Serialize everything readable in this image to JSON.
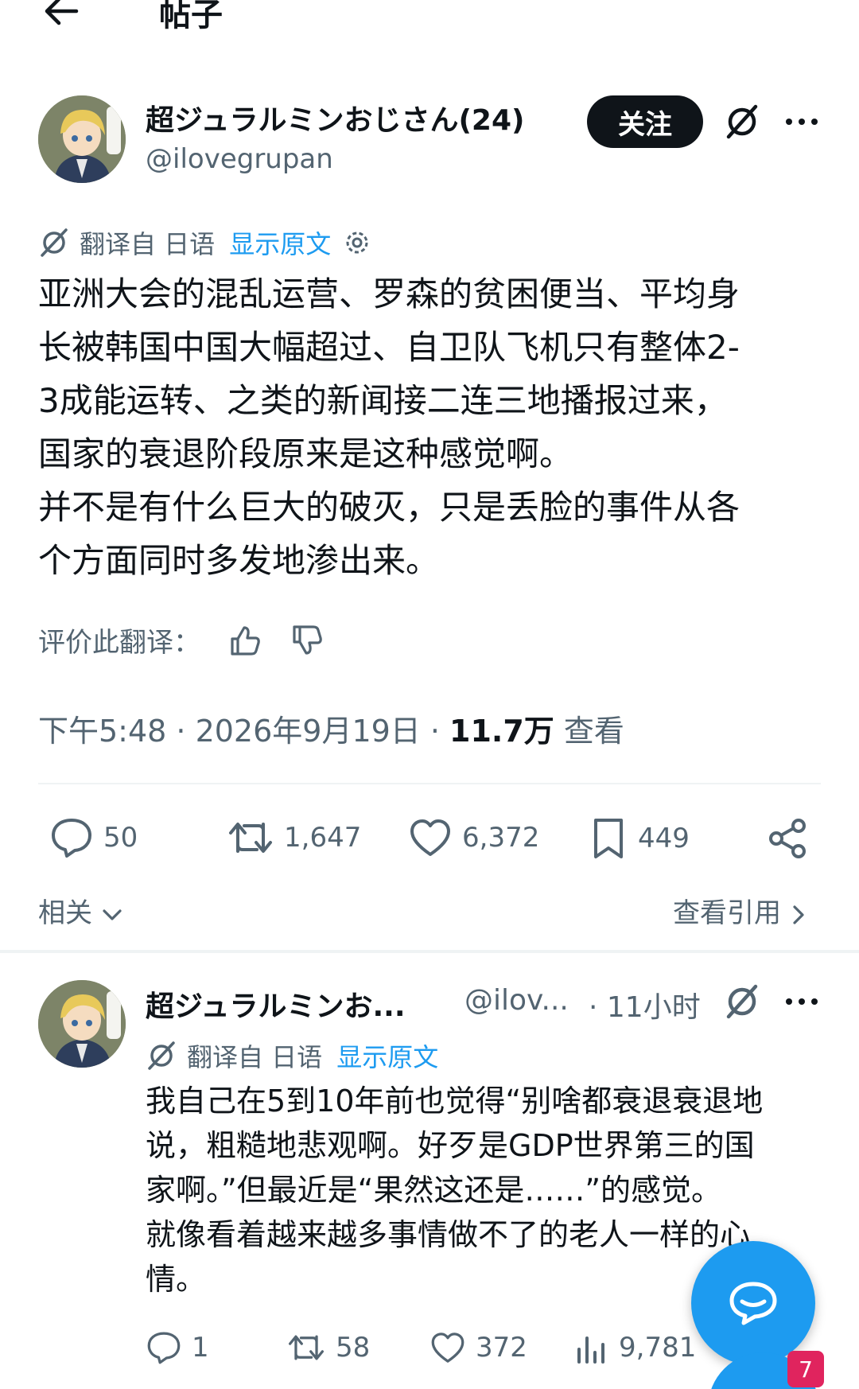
{
  "header": {
    "title": "帖子"
  },
  "post": {
    "author_name": "超ジュラルミンおじさん(24)",
    "author_handle": "@ilovegrupan",
    "follow_label": "关注",
    "translation": {
      "label": "翻译自 日语",
      "show_original": "显示原文"
    },
    "body_lines": [
      "亚洲大会的混乱运营、罗森的贫困便当、平均身",
      "长被韩国中国大幅超过、自卫队飞机只有整体2-",
      "3成能运转、之类的新闻接二连三地播报过来，",
      "国家的衰退阶段原来是这种感觉啊。",
      "并不是有什么巨大的破灭，只是丢脸的事件从各",
      "个方面同时多发地渗出来。"
    ],
    "rate_translation_label": "评价此翻译：",
    "timestamp": "下午5:48 · 2026年9月19日 · ",
    "views_count": "11.7万",
    "views_label": " 查看",
    "stats": {
      "replies": "50",
      "reposts": "1,647",
      "likes": "6,372",
      "bookmarks": "449"
    },
    "related_label": "相关",
    "view_quotes_label": "查看引用"
  },
  "reply": {
    "author_name": "超ジュラルミンお...",
    "author_handle": "@ilov...",
    "time": "· 11小时",
    "translation": {
      "label": "翻译自 日语",
      "show_original": "显示原文"
    },
    "body_lines": [
      "我自己在5到10年前也觉得“别啥都衰退衰退地",
      "说，粗糙地悲观啊。好歹是GDP世界第三的国",
      "家啊。”但最近是“果然这还是……”的感觉。",
      "就像看着越来越多事情做不了的老人一样的心",
      "情。"
    ],
    "stats": {
      "replies": "1",
      "reposts": "58",
      "likes": "372",
      "views": "9,781"
    }
  },
  "notification_badge": "7",
  "colors": {
    "accent": "#1d9bf0",
    "text_secondary": "#536471",
    "text_primary": "#0f1419",
    "badge": "#e0245e"
  },
  "icons": [
    "back-arrow-icon",
    "grok-icon",
    "more-icon",
    "translate-icon",
    "settings-icon",
    "thumbs-up-icon",
    "thumbs-down-icon",
    "reply-icon",
    "repost-icon",
    "like-icon",
    "bookmark-icon",
    "share-icon",
    "views-icon",
    "chevron-down-icon",
    "chevron-right-icon",
    "compose-message-icon"
  ]
}
